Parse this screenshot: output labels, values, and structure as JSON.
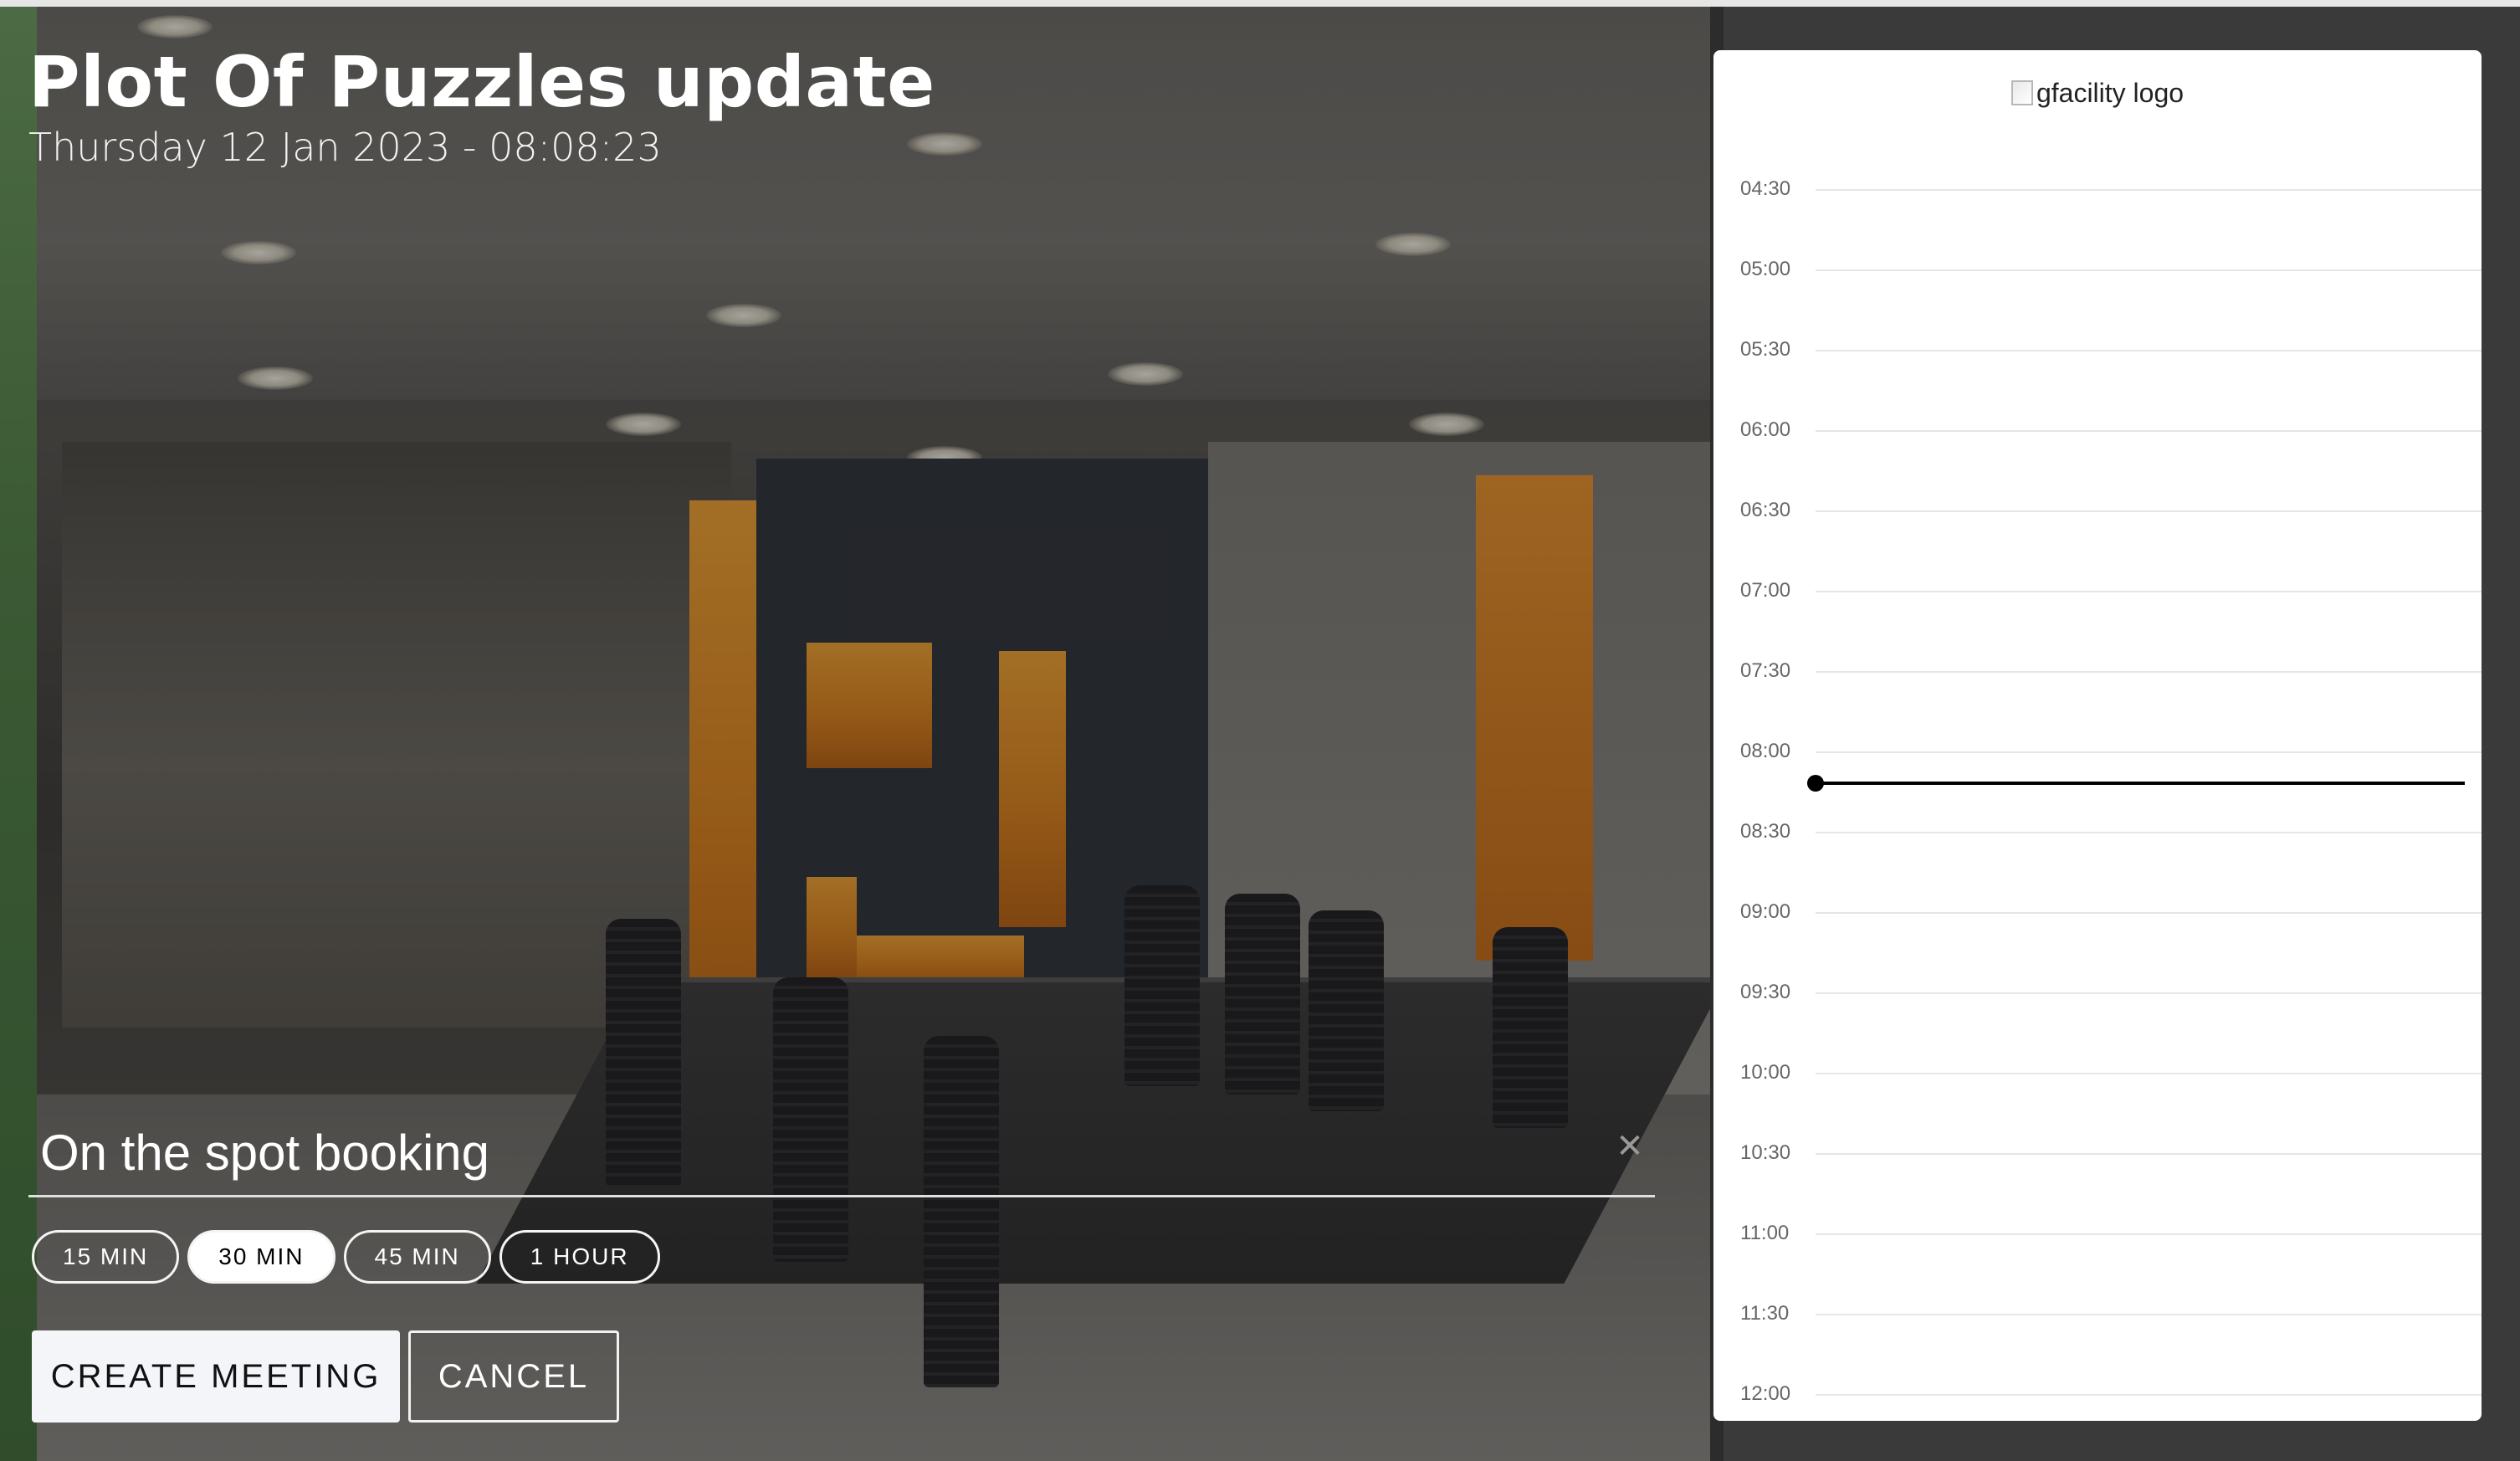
{
  "room": {
    "title": "Plot Of Puzzles update",
    "datetime": "Thursday 12 Jan 2023 - 08:08:23"
  },
  "booking": {
    "value": "On the spot booking",
    "placeholder": "On the spot booking",
    "clear_icon": "close-icon"
  },
  "durations": [
    {
      "label": "15 MIN",
      "selected": false
    },
    {
      "label": "30 MIN",
      "selected": true
    },
    {
      "label": "45 MIN",
      "selected": false
    },
    {
      "label": "1 HOUR",
      "selected": false
    }
  ],
  "actions": {
    "create_label": "CREATE MEETING",
    "cancel_label": "CANCEL"
  },
  "calendar": {
    "logo_alt": "gfacility logo",
    "times": [
      "04:30",
      "05:00",
      "05:30",
      "06:00",
      "06:30",
      "07:00",
      "07:30",
      "08:00",
      "08:30",
      "09:00",
      "09:30",
      "10:00",
      "10:30",
      "11:00",
      "11:30",
      "12:00"
    ],
    "current_time_marker": "08:08"
  },
  "colors": {
    "selected_chip_bg": "#ffffff",
    "primary_button_bg": "#f4f5f9",
    "now_line": "#000000",
    "accent_green": "#4f7f45"
  }
}
